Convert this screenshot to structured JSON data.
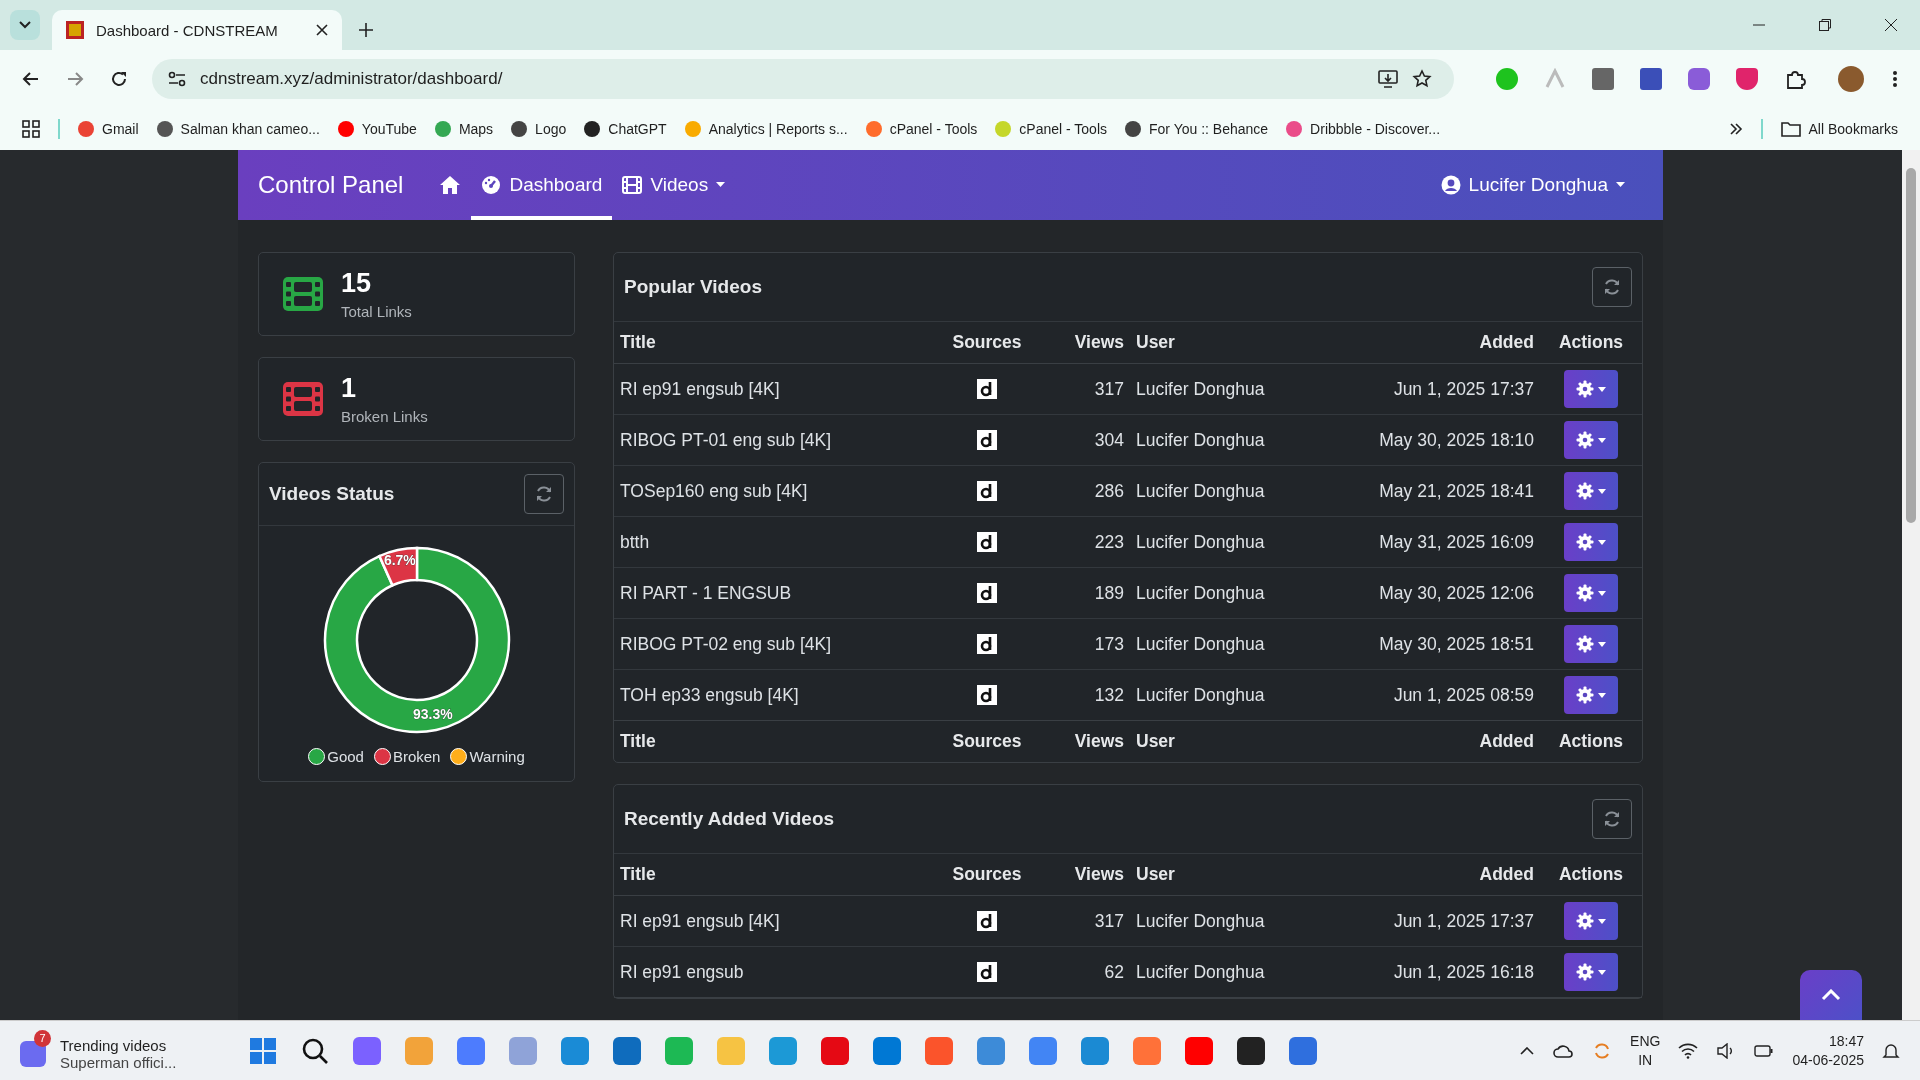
{
  "browser": {
    "tab_title": "Dashboard - CDNSTREAM",
    "url": "cdnstream.xyz/administrator/dashboard/",
    "bookmarks": [
      "Gmail",
      "Salman khan cameo...",
      "YouTube",
      "Maps",
      "Logo",
      "ChatGPT",
      "Analytics | Reports s...",
      "cPanel - Tools",
      "cPanel - Tools",
      "For You :: Behance",
      "Dribbble - Discover..."
    ],
    "all_bookmarks": "All Bookmarks"
  },
  "navbar": {
    "brand": "Control Panel",
    "items": [
      {
        "kind": "home",
        "selected": false
      },
      {
        "kind": "link",
        "label": "Dashboard",
        "selected": true
      },
      {
        "kind": "dropdown",
        "label": "Videos",
        "selected": false
      }
    ],
    "user": "Lucifer Donghua"
  },
  "stats": [
    {
      "value": "15",
      "label": "Total Links",
      "color": "#28a745"
    },
    {
      "value": "1",
      "label": "Broken Links",
      "color": "#dc3545"
    }
  ],
  "videos_status": {
    "title": "Videos Status",
    "chart_data": {
      "type": "donut",
      "categories": [
        "Good",
        "Broken",
        "Warning"
      ],
      "values": [
        93.3,
        6.7,
        0
      ],
      "value_labels": [
        "93.3%",
        "6.7%",
        null
      ],
      "colors": [
        "#28a745",
        "#dc3545",
        "#ffae1a"
      ]
    }
  },
  "tables": [
    {
      "title": "Popular Videos",
      "columns": [
        "Title",
        "Sources",
        "Views",
        "User",
        "Added",
        "Actions"
      ],
      "footer": [
        "Title",
        "Sources",
        "Views",
        "User",
        "Added",
        "Actions"
      ],
      "rows": [
        {
          "title": "RI ep91 engsub [4K]",
          "views": "317",
          "user": "Lucifer Donghua",
          "added": "Jun 1, 2025 17:37"
        },
        {
          "title": "RIBOG PT-01 eng sub [4K]",
          "views": "304",
          "user": "Lucifer Donghua",
          "added": "May 30, 2025 18:10"
        },
        {
          "title": "TOSep160 eng sub [4K]",
          "views": "286",
          "user": "Lucifer Donghua",
          "added": "May 21, 2025 18:41"
        },
        {
          "title": "btth",
          "views": "223",
          "user": "Lucifer Donghua",
          "added": "May 31, 2025 16:09"
        },
        {
          "title": "RI PART - 1 ENGSUB",
          "views": "189",
          "user": "Lucifer Donghua",
          "added": "May 30, 2025 12:06"
        },
        {
          "title": "RIBOG PT-02 eng sub [4K]",
          "views": "173",
          "user": "Lucifer Donghua",
          "added": "May 30, 2025 18:51"
        },
        {
          "title": "TOH ep33 engsub [4K]",
          "views": "132",
          "user": "Lucifer Donghua",
          "added": "Jun 1, 2025 08:59"
        }
      ]
    },
    {
      "title": "Recently Added Videos",
      "columns": [
        "Title",
        "Sources",
        "Views",
        "User",
        "Added",
        "Actions"
      ],
      "rows": [
        {
          "title": "RI ep91 engsub [4K]",
          "views": "317",
          "user": "Lucifer Donghua",
          "added": "Jun 1, 2025 17:37"
        },
        {
          "title": "RI ep91 engsub",
          "views": "62",
          "user": "Lucifer Donghua",
          "added": "Jun 1, 2025 16:18"
        }
      ]
    }
  ],
  "taskbar": {
    "notification_badge": "7",
    "notification_title": "Trending videos",
    "notification_subtitle": "Superman offici...",
    "language": "ENG",
    "region": "IN",
    "time": "18:47",
    "date": "04-06-2025"
  }
}
